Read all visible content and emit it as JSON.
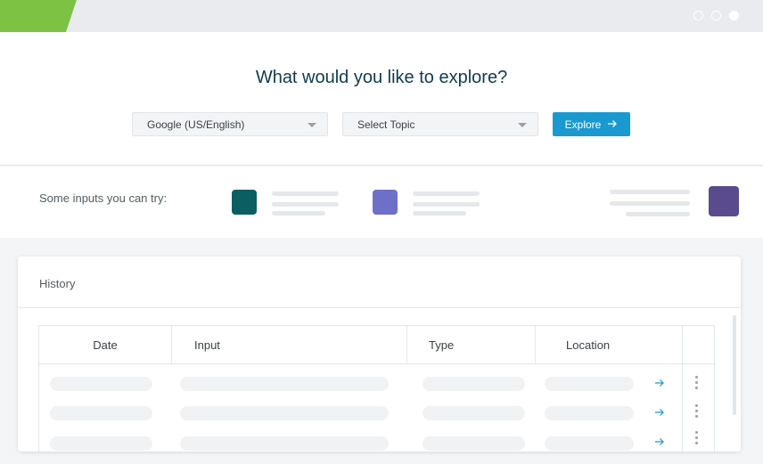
{
  "window": {
    "controls": [
      "window-dot-icon",
      "window-dot-icon",
      "window-dot-filled-icon"
    ]
  },
  "hero": {
    "title": "What would you like to explore?",
    "source_select": {
      "value": "Google (US/English)",
      "icon": "chevron-down-icon"
    },
    "topic_select": {
      "placeholder": "Select Topic",
      "icon": "chevron-down-icon"
    },
    "explore_button": {
      "label": "Explore",
      "icon": "arrow-right-icon"
    }
  },
  "suggestions": {
    "label": "Some inputs you can try:",
    "swatch_colors": [
      "#0b5f63",
      "#6e6fc9",
      "#5a4b8e"
    ]
  },
  "history": {
    "title": "History",
    "columns": [
      "Date",
      "Input",
      "Type",
      "Location"
    ],
    "rows": [
      {
        "action_icon": "arrow-right-icon",
        "menu_icon": "more-vertical-icon"
      },
      {
        "action_icon": "arrow-right-icon",
        "menu_icon": "more-vertical-icon"
      },
      {
        "action_icon": "arrow-right-icon",
        "menu_icon": "more-vertical-icon"
      }
    ]
  },
  "colors": {
    "brand_green": "#7dc242",
    "accent_blue": "#1a99d0",
    "title_dark": "#0f3b4f"
  }
}
